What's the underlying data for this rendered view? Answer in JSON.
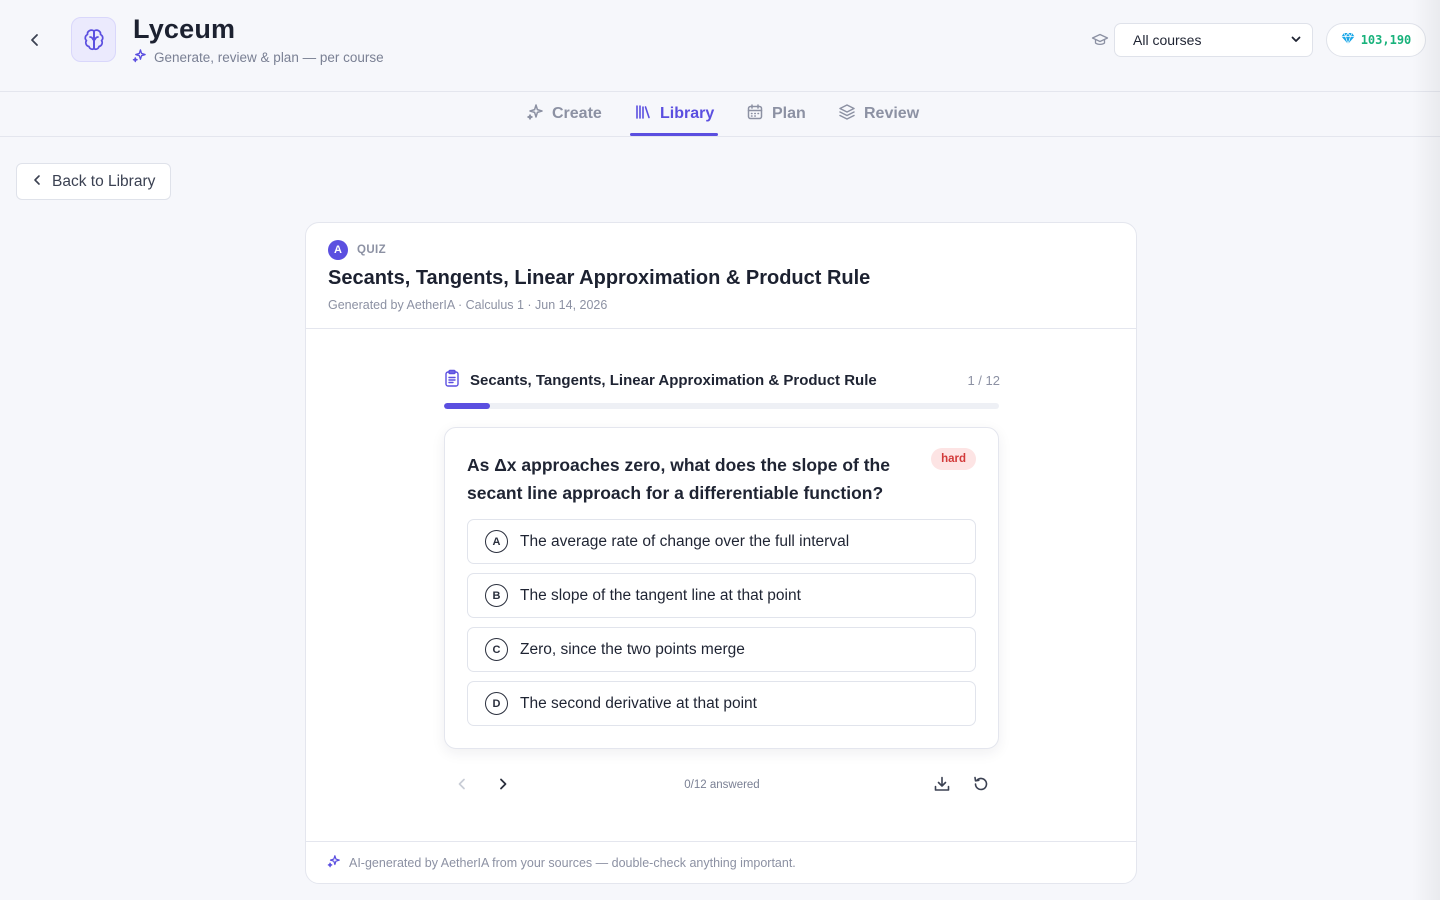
{
  "header": {
    "app_title": "Lyceum",
    "app_subtitle": "Generate, review & plan — per course",
    "course_select": {
      "value": "All courses"
    },
    "gems": "103,190"
  },
  "tabs": [
    {
      "label": "Create",
      "icon": "sparkles-icon",
      "active": false
    },
    {
      "label": "Library",
      "icon": "library-icon",
      "active": true
    },
    {
      "label": "Plan",
      "icon": "calendar-icon",
      "active": false
    },
    {
      "label": "Review",
      "icon": "layers-icon",
      "active": false
    }
  ],
  "back_button": {
    "label": "Back to Library"
  },
  "card": {
    "type_avatar": "A",
    "type_label": "QUIZ",
    "title": "Secants, Tangents, Linear Approximation & Product Rule",
    "meta": "Generated by AetherIA · Calculus 1 · Jun 14, 2026",
    "footer_note": "AI-generated by AetherIA from your sources — double-check anything important."
  },
  "quiz": {
    "title": "Secants, Tangents, Linear Approximation & Product Rule",
    "progress_label": "1 / 12",
    "progress_fraction": 0.083,
    "answered_label": "0/12 answered",
    "question": {
      "text": "As Δx approaches zero, what does the slope of the secant line approach for a differentiable function?",
      "difficulty": "hard",
      "options": [
        {
          "letter": "A",
          "text": "The average rate of change over the full interval"
        },
        {
          "letter": "B",
          "text": "The slope of the tangent line at that point"
        },
        {
          "letter": "C",
          "text": "Zero, since the two points merge"
        },
        {
          "letter": "D",
          "text": "The second derivative at that point"
        }
      ]
    }
  },
  "colors": {
    "accent": "#5b4fe0",
    "gems": "#18b27b",
    "hard_bg": "#fde4e4",
    "hard_text": "#d23a3a"
  }
}
